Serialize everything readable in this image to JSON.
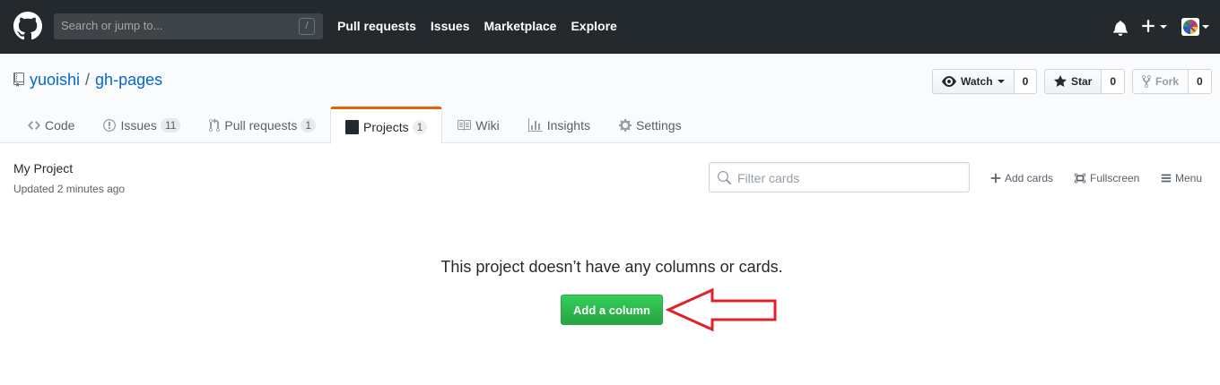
{
  "header": {
    "search_placeholder": "Search or jump to...",
    "search_shortcut": "/",
    "nav": [
      "Pull requests",
      "Issues",
      "Marketplace",
      "Explore"
    ],
    "icons": [
      "github-logo-icon",
      "bell-icon",
      "plus-icon",
      "avatar"
    ]
  },
  "repo": {
    "owner": "yuoishi",
    "separator": "/",
    "name": "gh-pages",
    "watch": {
      "label": "Watch",
      "count": "0"
    },
    "star": {
      "label": "Star",
      "count": "0"
    },
    "fork": {
      "label": "Fork",
      "count": "0"
    }
  },
  "tabs": [
    {
      "label": "Code",
      "count": ""
    },
    {
      "label": "Issues",
      "count": "11"
    },
    {
      "label": "Pull requests",
      "count": "1"
    },
    {
      "label": "Projects",
      "count": "1",
      "selected": true
    },
    {
      "label": "Wiki",
      "count": ""
    },
    {
      "label": "Insights",
      "count": ""
    },
    {
      "label": "Settings",
      "count": ""
    }
  ],
  "project": {
    "name": "My Project",
    "updated": "Updated 2 minutes ago",
    "filter_placeholder": "Filter cards",
    "add_cards": "Add cards",
    "fullscreen": "Fullscreen",
    "menu": "Menu"
  },
  "blankslate": {
    "message": "This project doesn’t have any columns or cards.",
    "button": "Add a column"
  },
  "colors": {
    "header_bg": "#24292e",
    "link": "#0366d6",
    "tab_accent": "#e36209",
    "primary_button": "#28a745",
    "annotation": "#e0202a"
  }
}
